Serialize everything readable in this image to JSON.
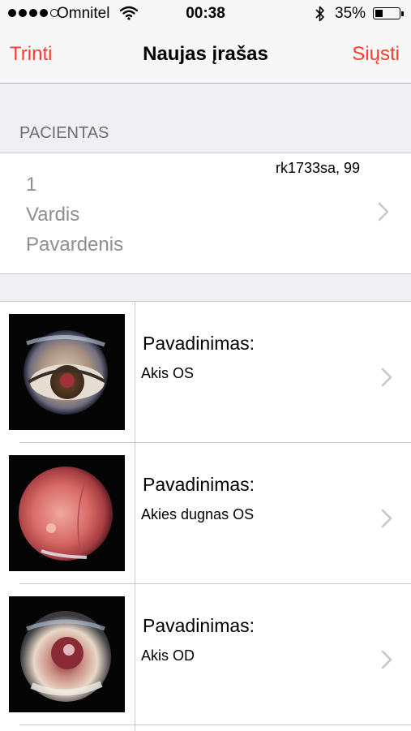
{
  "status_bar": {
    "carrier": "Omnitel",
    "time": "00:38",
    "battery_percent_label": "35%",
    "battery_level": 0.35,
    "signal_bars": 4,
    "signal_max": 5
  },
  "nav": {
    "left_label": "Trinti",
    "title": "Naujas įrašas",
    "right_label": "Siųsti",
    "accent_color": "#ff3b30"
  },
  "patient_section": {
    "header": "PACIENTAS",
    "number": "1",
    "first_name": "Vardis",
    "last_name": "Pavardenis",
    "code": "rk1733sa, 99"
  },
  "records": [
    {
      "label": "Pavadinimas:",
      "value": "Akis OS",
      "image": "eye-exterior-photo"
    },
    {
      "label": "Pavadinimas:",
      "value": "Akies dugnas OS",
      "image": "fundus-photo"
    },
    {
      "label": "Pavadinimas:",
      "value": "Akis OD",
      "image": "eye-closeup-photo"
    }
  ],
  "icons": {
    "wifi": "wifi-icon",
    "bluetooth": "bluetooth-icon",
    "battery": "battery-icon",
    "chevron": "chevron-right-icon"
  }
}
